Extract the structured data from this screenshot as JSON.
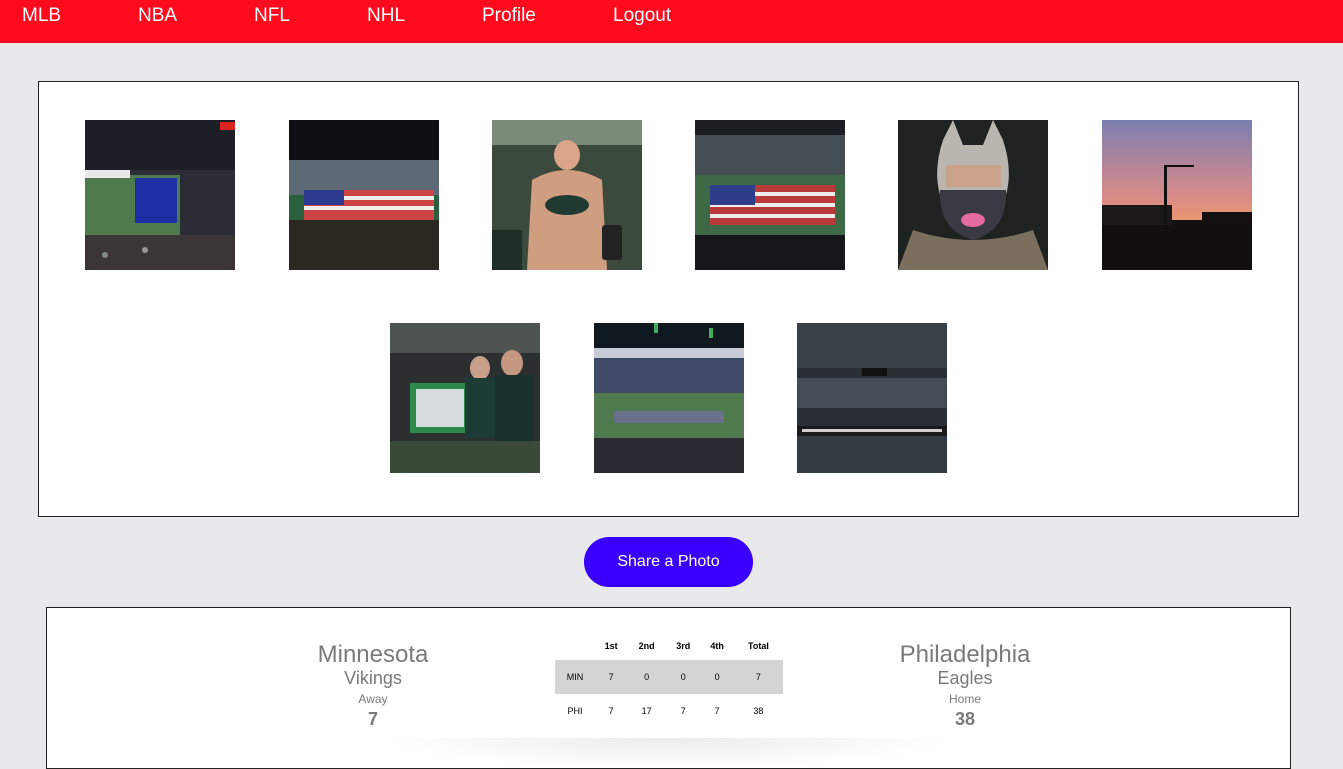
{
  "nav": {
    "items": [
      "MLB",
      "NBA",
      "NFL",
      "NHL",
      "Profile",
      "Logout"
    ]
  },
  "gallery": {
    "photos": [
      "stadium-scoreboard-photo",
      "stadium-flag-smoke-photo",
      "shirtless-eagles-fan-photo",
      "stadium-flag-field-photo",
      "masked-fan-selfie-photo",
      "stadium-sunset-photo",
      "fans-with-trophy-sign-photo",
      "stadium-field-celebration-photo",
      "stadium-crowd-banner-photo"
    ]
  },
  "share_button": {
    "label": "Share a Photo"
  },
  "game": {
    "away": {
      "city": "Minnesota",
      "name": "Vikings",
      "side": "Away",
      "score": "7"
    },
    "home": {
      "city": "Philadelphia",
      "name": "Eagles",
      "side": "Home",
      "score": "38"
    },
    "box": {
      "headers": [
        "",
        "1st",
        "2nd",
        "3rd",
        "4th",
        "Total"
      ],
      "rows": [
        {
          "team": "MIN",
          "q1": "7",
          "q2": "0",
          "q3": "0",
          "q4": "0",
          "total": "7"
        },
        {
          "team": "PHI",
          "q1": "7",
          "q2": "17",
          "q3": "7",
          "q4": "7",
          "total": "38"
        }
      ]
    }
  },
  "colors": {
    "nav_bg": "#ff0b1d",
    "button_bg": "#3a00ff",
    "page_bg": "#e9e9eb"
  }
}
